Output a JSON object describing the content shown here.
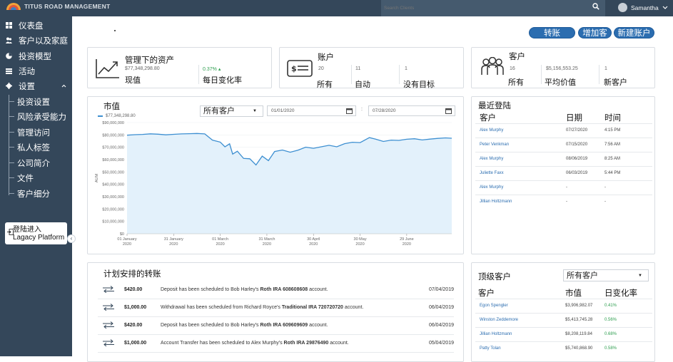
{
  "app": {
    "logo_text": "TITUS ROAD MANAGEMENT"
  },
  "search": {
    "placeholder": "Search Clients"
  },
  "user": {
    "name": "Samantha"
  },
  "sidebar": {
    "items": [
      {
        "label": "仪表盘",
        "icon": "dashboard-icon"
      },
      {
        "label": "客户以及家庭",
        "icon": "users-icon"
      },
      {
        "label": "投资模型",
        "icon": "pie-chart-icon"
      },
      {
        "label": "活动",
        "icon": "list-icon"
      },
      {
        "label": "设置",
        "icon": "gear-icon"
      }
    ],
    "settings_sub": [
      "投资设置",
      "风险承受能力",
      "管理访问",
      "私人标签",
      "公司简介",
      "文件",
      "客户细分"
    ],
    "legacy": {
      "line1": "登陆进入",
      "line2": "Lagacy Platform"
    }
  },
  "actions": {
    "transfer": "转账",
    "add_client": "增加客户",
    "new_account": "新建账户"
  },
  "aum_card": {
    "title": "管理下的资产",
    "value": "$77,348,298.80",
    "value_label": "现值",
    "change": "0.37%",
    "change_label": "每日变化率"
  },
  "accounts_card": {
    "title": "账户",
    "all_count": "20",
    "all_label": "所有",
    "auto_count": "11",
    "auto_label": "自动",
    "nogoal_count": "1",
    "nogoal_label": "没有目标"
  },
  "clients_card": {
    "title": "客户",
    "all_count": "16",
    "all_label": "所有",
    "avg_value": "$5,156,553.25",
    "avg_label": "平均价值",
    "new_count": "1",
    "new_label": "新客户"
  },
  "market": {
    "title": "市值",
    "filter": "所有客户",
    "date_from": "01/01/2020",
    "date_to": "07/28/2020",
    "legend": "$77,348,298.80"
  },
  "chart_data": {
    "type": "area",
    "ylabel": "AUM",
    "ylim": [
      0,
      90000000
    ],
    "yticks": [
      "$0",
      "$10,000,000",
      "$20,000,000",
      "$30,000,000",
      "$40,000,000",
      "$50,000,000",
      "$60,000,000",
      "$70,000,000",
      "$80,000,000",
      "$90,000,000"
    ],
    "xticks": [
      [
        "01 January",
        "2020"
      ],
      [
        "31 January",
        "2020"
      ],
      [
        "01 March",
        "2020"
      ],
      [
        "31 March",
        "2020"
      ],
      [
        "30 April",
        "2020"
      ],
      [
        "30 May",
        "2020"
      ],
      [
        "29 June",
        "2020"
      ]
    ],
    "x_range": [
      "2020-01-01",
      "2020-07-28"
    ],
    "series": [
      {
        "values": [
          [
            "2020-01-01",
            79800000
          ],
          [
            "2020-01-06",
            80200000
          ],
          [
            "2020-01-11",
            80400000
          ],
          [
            "2020-01-16",
            80900000
          ],
          [
            "2020-01-21",
            80600000
          ],
          [
            "2020-01-26",
            80100000
          ],
          [
            "2020-01-31",
            80500000
          ],
          [
            "2020-02-05",
            80800000
          ],
          [
            "2020-02-10",
            81000000
          ],
          [
            "2020-02-15",
            81200000
          ],
          [
            "2020-02-20",
            80800000
          ],
          [
            "2020-02-25",
            75800000
          ],
          [
            "2020-03-01",
            74200000
          ],
          [
            "2020-03-04",
            70400000
          ],
          [
            "2020-03-07",
            72800000
          ],
          [
            "2020-03-09",
            64500000
          ],
          [
            "2020-03-12",
            66800000
          ],
          [
            "2020-03-16",
            61000000
          ],
          [
            "2020-03-20",
            60700000
          ],
          [
            "2020-03-24",
            55700000
          ],
          [
            "2020-03-28",
            62800000
          ],
          [
            "2020-04-01",
            59200000
          ],
          [
            "2020-04-05",
            66600000
          ],
          [
            "2020-04-10",
            67800000
          ],
          [
            "2020-04-15",
            66000000
          ],
          [
            "2020-04-20",
            67700000
          ],
          [
            "2020-04-25",
            70100000
          ],
          [
            "2020-04-30",
            69200000
          ],
          [
            "2020-05-05",
            70400000
          ],
          [
            "2020-05-10",
            71600000
          ],
          [
            "2020-05-15",
            70400000
          ],
          [
            "2020-05-20",
            72900000
          ],
          [
            "2020-05-25",
            74100000
          ],
          [
            "2020-05-30",
            73800000
          ],
          [
            "2020-06-05",
            77800000
          ],
          [
            "2020-06-09",
            76600000
          ],
          [
            "2020-06-14",
            74700000
          ],
          [
            "2020-06-19",
            75800000
          ],
          [
            "2020-06-24",
            75600000
          ],
          [
            "2020-06-29",
            76500000
          ],
          [
            "2020-07-04",
            76900000
          ],
          [
            "2020-07-09",
            75900000
          ],
          [
            "2020-07-14",
            76600000
          ],
          [
            "2020-07-19",
            77200000
          ],
          [
            "2020-07-24",
            77600000
          ],
          [
            "2020-07-28",
            77300000
          ]
        ]
      }
    ]
  },
  "recent_logins": {
    "title": "最近登陆",
    "col_client": "客户",
    "col_date": "日期",
    "col_time": "时间",
    "rows": [
      [
        "Alex Murphy",
        "07/27/2020",
        "4:15 PM"
      ],
      [
        "Peter Venkman",
        "07/15/2020",
        "7:56 AM"
      ],
      [
        "Alex Murphy",
        "08/06/2019",
        "8:25 AM"
      ],
      [
        "Juliette Faxx",
        "06/03/2019",
        "5:44 PM"
      ],
      [
        "Alex Murphy",
        "-",
        "-"
      ],
      [
        "Jillian Holtzmann",
        "-",
        "-"
      ]
    ]
  },
  "scheduled": {
    "title": "计划安排的转账",
    "rows": [
      {
        "amount": "$420.00",
        "pre": "Deposit has been scheduled to Bob Harley's ",
        "bold": "Roth IRA 608608608",
        "post": " account.",
        "date": "07/04/2019"
      },
      {
        "amount": "$1,000.00",
        "pre": "Withdrawal has been scheduled from Richard Royce's ",
        "bold": "Traditional IRA 720720720",
        "post": " account.",
        "date": "06/04/2019"
      },
      {
        "amount": "$420.00",
        "pre": "Deposit has been scheduled to Bob Harley's ",
        "bold": "Roth IRA 609609609",
        "post": " account.",
        "date": "06/04/2019"
      },
      {
        "amount": "$1,000.00",
        "pre": "Account Transfer has been scheduled to Alex Murphy's  ",
        "bold": "Roth IRA 29876490",
        "post": " account.",
        "date": "05/04/2019"
      }
    ]
  },
  "top_clients": {
    "title": "顶级客户",
    "filter": "所有客户",
    "col_client": "客户",
    "col_value": "市值",
    "col_change": "日变化率",
    "rows": [
      [
        "Egon Spengler",
        "$3,906,982.07",
        "0.41%"
      ],
      [
        "Winston Zeddemore",
        "$5,413,745.28",
        "0.56%"
      ],
      [
        "Jillian Holtzmann",
        "$8,208,119.84",
        "0.68%"
      ],
      [
        "Patty Tolan",
        "$5,740,868.90",
        "0.58%"
      ]
    ]
  },
  "colors": {
    "sidebar": "#34475a",
    "accent": "#2b6db0",
    "line": "#3d8fd1",
    "area": "#e3f1fb",
    "positive": "#2e9e4f"
  }
}
